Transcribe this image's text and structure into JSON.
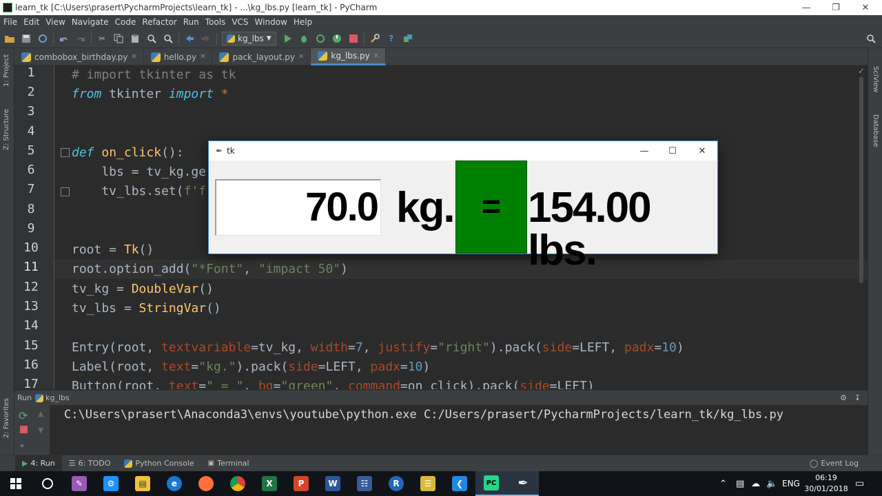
{
  "window": {
    "title": "learn_tk [C:\\Users\\prasert\\PycharmProjects\\learn_tk] - ...\\kg_lbs.py [learn_tk] - PyCharm"
  },
  "menu": [
    "File",
    "Edit",
    "View",
    "Navigate",
    "Code",
    "Refactor",
    "Run",
    "Tools",
    "VCS",
    "Window",
    "Help"
  ],
  "toolbar": {
    "run_config": "kg_lbs"
  },
  "side_tabs": {
    "project": "1: Project",
    "structure": "Z: Structure",
    "favorites": "2: Favorites",
    "sciview": "SciView",
    "database": "Database"
  },
  "tabs": [
    {
      "label": "combobox_birthday.py",
      "active": false
    },
    {
      "label": "hello.py",
      "active": false
    },
    {
      "label": "pack_layout.py",
      "active": false
    },
    {
      "label": "kg_lbs.py",
      "active": true
    }
  ],
  "line_numbers": [
    "1",
    "2",
    "3",
    "4",
    "5",
    "6",
    "7",
    "8",
    "9",
    "10",
    "11",
    "12",
    "13",
    "14",
    "15",
    "16",
    "17"
  ],
  "code": {
    "l1": "# import tkinter as tk",
    "l2_kw1": "from",
    "l2_mod": " tkinter ",
    "l2_kw2": "import",
    "l2_star": " *",
    "l5_kw": "def",
    "l5_fn": " on_click",
    "l5_rest": "():",
    "l6": "    lbs = tv_kg.ge",
    "l7a": "    tv_lbs.set(",
    "l7b": "f'f",
    "l10a": "root = ",
    "l10b": "Tk",
    "l10c": "()",
    "l11a": "root.option_add(",
    "l11b": "\"*Font\"",
    "l11c": ", ",
    "l11d": "\"impact 50\"",
    "l11e": ")",
    "l12a": "tv_kg = ",
    "l12b": "DoubleVar",
    "l12c": "()",
    "l13a": "tv_lbs = ",
    "l13b": "StringVar",
    "l13c": "()",
    "l15": {
      "a": "Entry(root, ",
      "b": "textvariable",
      "c": "=tv_kg, ",
      "d": "width",
      "e": "=",
      "f": "7",
      "g": ", ",
      "h": "justify",
      "i": "=",
      "j": "\"right\"",
      "k": ").pack(",
      "l": "side",
      "m": "=LEFT, ",
      "n": "padx",
      "o": "=",
      "p": "10",
      "q": ")"
    },
    "l16": {
      "a": "Label(root, ",
      "b": "text",
      "c": "=",
      "d": "\"kg.\"",
      "e": ").pack(",
      "f": "side",
      "g": "=LEFT, ",
      "h": "padx",
      "i": "=",
      "j": "10",
      "k": ")"
    },
    "l17": {
      "a": "Button(root, ",
      "b": "text",
      "c": "=",
      "d": "\" = \"",
      "e": ", ",
      "f": "bg",
      "g": "=",
      "h": "\"green\"",
      "i": ", ",
      "j": "command",
      "k": "=on_click).pack(",
      "l": "side",
      "m": "=LEFT)"
    }
  },
  "tk": {
    "title": "tk",
    "entry_value": "70.0",
    "label_kg": "kg.",
    "button_label": "=",
    "result": "154.00 lbs.",
    "button_color": "#008000"
  },
  "run": {
    "header_label": "Run",
    "config": "kg_lbs",
    "output": "C:\\Users\\prasert\\Anaconda3\\envs\\youtube\\python.exe C:/Users/prasert/PycharmProjects/learn_tk/kg_lbs.py"
  },
  "bottom_tabs": {
    "run": "4: Run",
    "todo": "6: TODO",
    "console": "Python Console",
    "terminal": "Terminal",
    "eventlog": "Event Log"
  },
  "taskbar": {
    "lang": "ENG",
    "time": "06:19",
    "date": "30/01/2018"
  }
}
